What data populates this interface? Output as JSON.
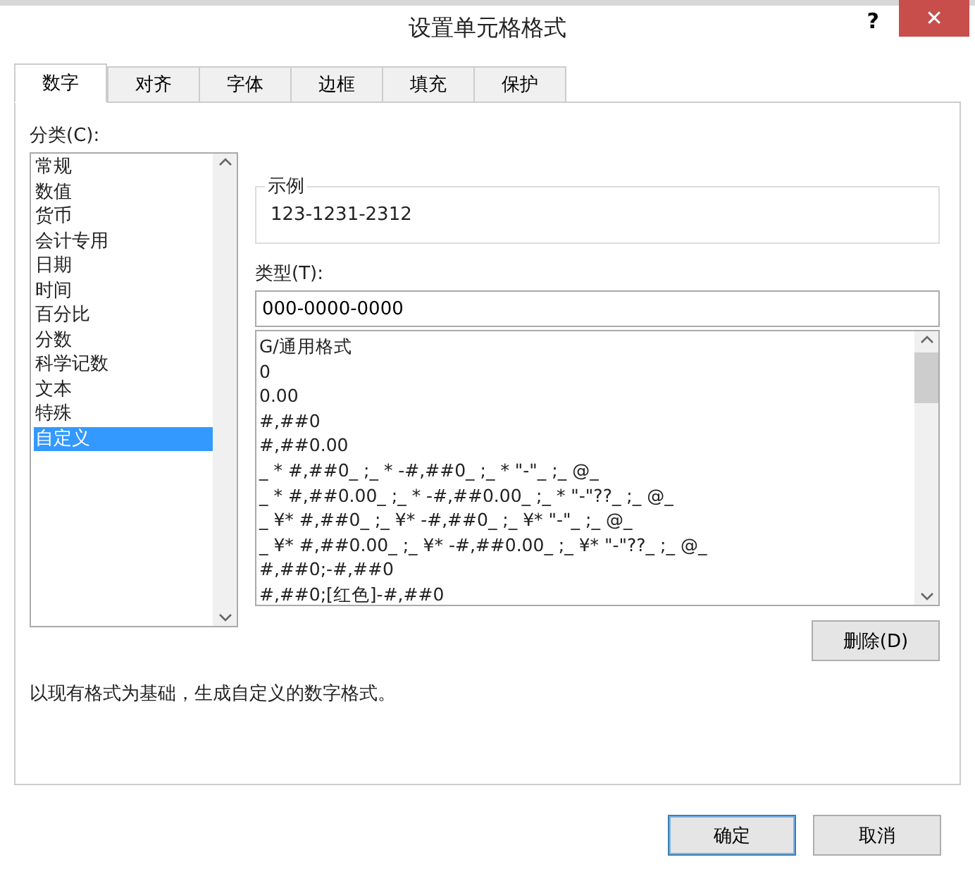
{
  "window": {
    "title": "设置单元格格式",
    "help": "?",
    "close": "✕"
  },
  "tabs": [
    {
      "label": "数字",
      "selected": true
    },
    {
      "label": "对齐",
      "selected": false
    },
    {
      "label": "字体",
      "selected": false
    },
    {
      "label": "边框",
      "selected": false
    },
    {
      "label": "填充",
      "selected": false
    },
    {
      "label": "保护",
      "selected": false
    }
  ],
  "category_label": "分类(C):",
  "categories": [
    {
      "label": "常规",
      "selected": false
    },
    {
      "label": "数值",
      "selected": false
    },
    {
      "label": "货币",
      "selected": false
    },
    {
      "label": "会计专用",
      "selected": false
    },
    {
      "label": "日期",
      "selected": false
    },
    {
      "label": "时间",
      "selected": false
    },
    {
      "label": "百分比",
      "selected": false
    },
    {
      "label": "分数",
      "selected": false
    },
    {
      "label": "科学记数",
      "selected": false
    },
    {
      "label": "文本",
      "selected": false
    },
    {
      "label": "特殊",
      "selected": false
    },
    {
      "label": "自定义",
      "selected": true
    }
  ],
  "sample": {
    "label": "示例",
    "value": "123-1231-2312"
  },
  "type_label": "类型(T):",
  "type_value": "000-0000-0000",
  "types": [
    "G/通用格式",
    "0",
    "0.00",
    "#,##0",
    "#,##0.00",
    "_ * #,##0_ ;_ * -#,##0_ ;_ * \"-\"_ ;_ @_",
    "_ * #,##0.00_ ;_ * -#,##0.00_ ;_ * \"-\"??_ ;_ @_",
    "_ ¥* #,##0_ ;_ ¥* -#,##0_ ;_ ¥* \"-\"_ ;_ @_",
    "_ ¥* #,##0.00_ ;_ ¥* -#,##0.00_ ;_ ¥* \"-\"??_ ;_ @_",
    "#,##0;-#,##0",
    "#,##0;[红色]-#,##0"
  ],
  "delete_button": "删除(D)",
  "description": "以现有格式为基础，生成自定义的数字格式。",
  "buttons": [
    "确定",
    "取消"
  ]
}
